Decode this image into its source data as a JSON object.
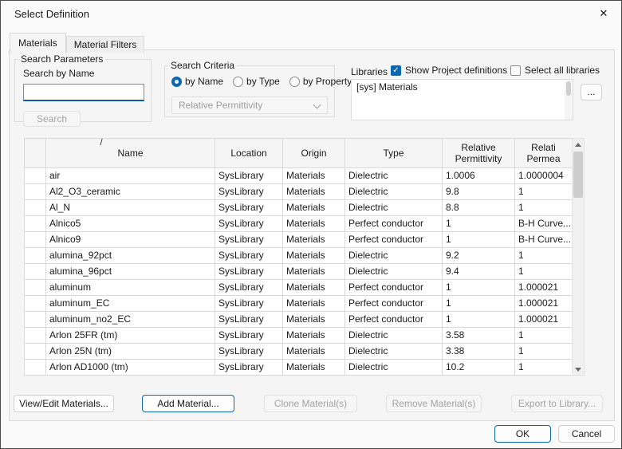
{
  "dialog": {
    "title": "Select Definition",
    "close_icon": "✕"
  },
  "tabs": [
    {
      "label": "Materials",
      "active": true
    },
    {
      "label": "Material Filters",
      "active": false
    }
  ],
  "search_parameters": {
    "group_label": "Search Parameters",
    "field_label": "Search by Name",
    "input_value": "",
    "search_button": "Search"
  },
  "search_criteria": {
    "group_label": "Search Criteria",
    "radios": [
      {
        "label": "by Name",
        "selected": true
      },
      {
        "label": "by Type",
        "selected": false
      },
      {
        "label": "by Property",
        "selected": false
      }
    ],
    "property_dropdown": "Relative Permittivity"
  },
  "libraries": {
    "label": "Libraries",
    "show_project_definitions": {
      "label": "Show Project definitions",
      "checked": true
    },
    "select_all_libraries": {
      "label": "Select all libraries",
      "checked": false
    },
    "list_items": [
      "[sys] Materials"
    ],
    "more_button": "..."
  },
  "table": {
    "sort_indicator": "/",
    "columns": [
      "",
      "Name",
      "Location",
      "Origin",
      "Type",
      "Relative\nPermittivity",
      "Relati\nPermea"
    ],
    "rows": [
      [
        "air",
        "SysLibrary",
        "Materials",
        "Dielectric",
        "1.0006",
        "1.0000004"
      ],
      [
        "Al2_O3_ceramic",
        "SysLibrary",
        "Materials",
        "Dielectric",
        "9.8",
        "1"
      ],
      [
        "Al_N",
        "SysLibrary",
        "Materials",
        "Dielectric",
        "8.8",
        "1"
      ],
      [
        "Alnico5",
        "SysLibrary",
        "Materials",
        "Perfect conductor",
        "1",
        "B-H Curve..."
      ],
      [
        "Alnico9",
        "SysLibrary",
        "Materials",
        "Perfect conductor",
        "1",
        "B-H Curve..."
      ],
      [
        "alumina_92pct",
        "SysLibrary",
        "Materials",
        "Dielectric",
        "9.2",
        "1"
      ],
      [
        "alumina_96pct",
        "SysLibrary",
        "Materials",
        "Dielectric",
        "9.4",
        "1"
      ],
      [
        "aluminum",
        "SysLibrary",
        "Materials",
        "Perfect conductor",
        "1",
        "1.000021"
      ],
      [
        "aluminum_EC",
        "SysLibrary",
        "Materials",
        "Perfect conductor",
        "1",
        "1.000021"
      ],
      [
        "aluminum_no2_EC",
        "SysLibrary",
        "Materials",
        "Perfect conductor",
        "1",
        "1.000021"
      ],
      [
        "Arlon 25FR (tm)",
        "SysLibrary",
        "Materials",
        "Dielectric",
        "3.58",
        "1"
      ],
      [
        "Arlon 25N (tm)",
        "SysLibrary",
        "Materials",
        "Dielectric",
        "3.38",
        "1"
      ],
      [
        "Arlon AD1000 (tm)",
        "SysLibrary",
        "Materials",
        "Dielectric",
        "10.2",
        "1"
      ]
    ]
  },
  "action_buttons": {
    "view_edit": "View/Edit Materials...",
    "add": "Add Material...",
    "clone": "Clone Material(s)",
    "remove": "Remove Material(s)",
    "export": "Export to Library..."
  },
  "footer": {
    "ok": "OK",
    "cancel": "Cancel"
  },
  "colors": {
    "accent": "#0b67b2",
    "grid": "#d9d9d9",
    "disabled_text": "#a3a3a3"
  }
}
